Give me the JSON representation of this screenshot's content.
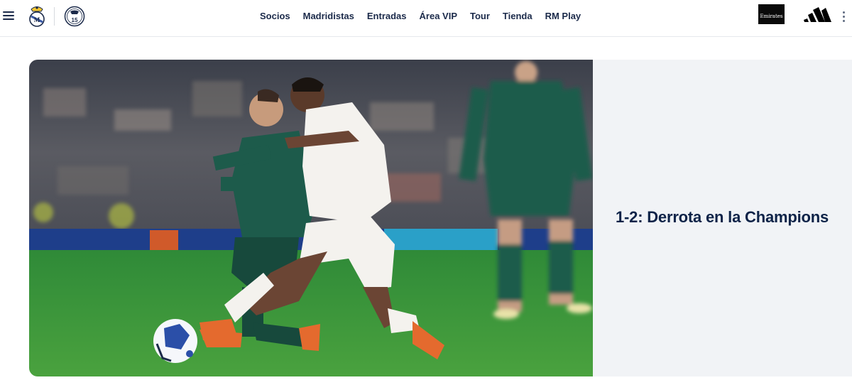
{
  "header": {
    "nav": [
      "Socios",
      "Madridistas",
      "Entradas",
      "Área VIP",
      "Tour",
      "Tienda",
      "RM Play"
    ],
    "sponsor_text": "Emirates",
    "badge_number": "15",
    "icons": {
      "menu": "hamburger-menu-icon",
      "crest": "real-madrid-crest-icon",
      "badge": "fifteen-champions-badge-icon",
      "sponsor": "emirates-logo-icon",
      "kit": "adidas-logo-icon",
      "more": "kebab-more-icon"
    }
  },
  "hero": {
    "headline": "1-2: Derrota en la Champions"
  },
  "colors": {
    "navy": "#1b2a4a",
    "headline": "#0e2348",
    "panel": "#f1f3f6",
    "pitch": "#3f9a3a",
    "away_kit": "#1d5b4b"
  }
}
